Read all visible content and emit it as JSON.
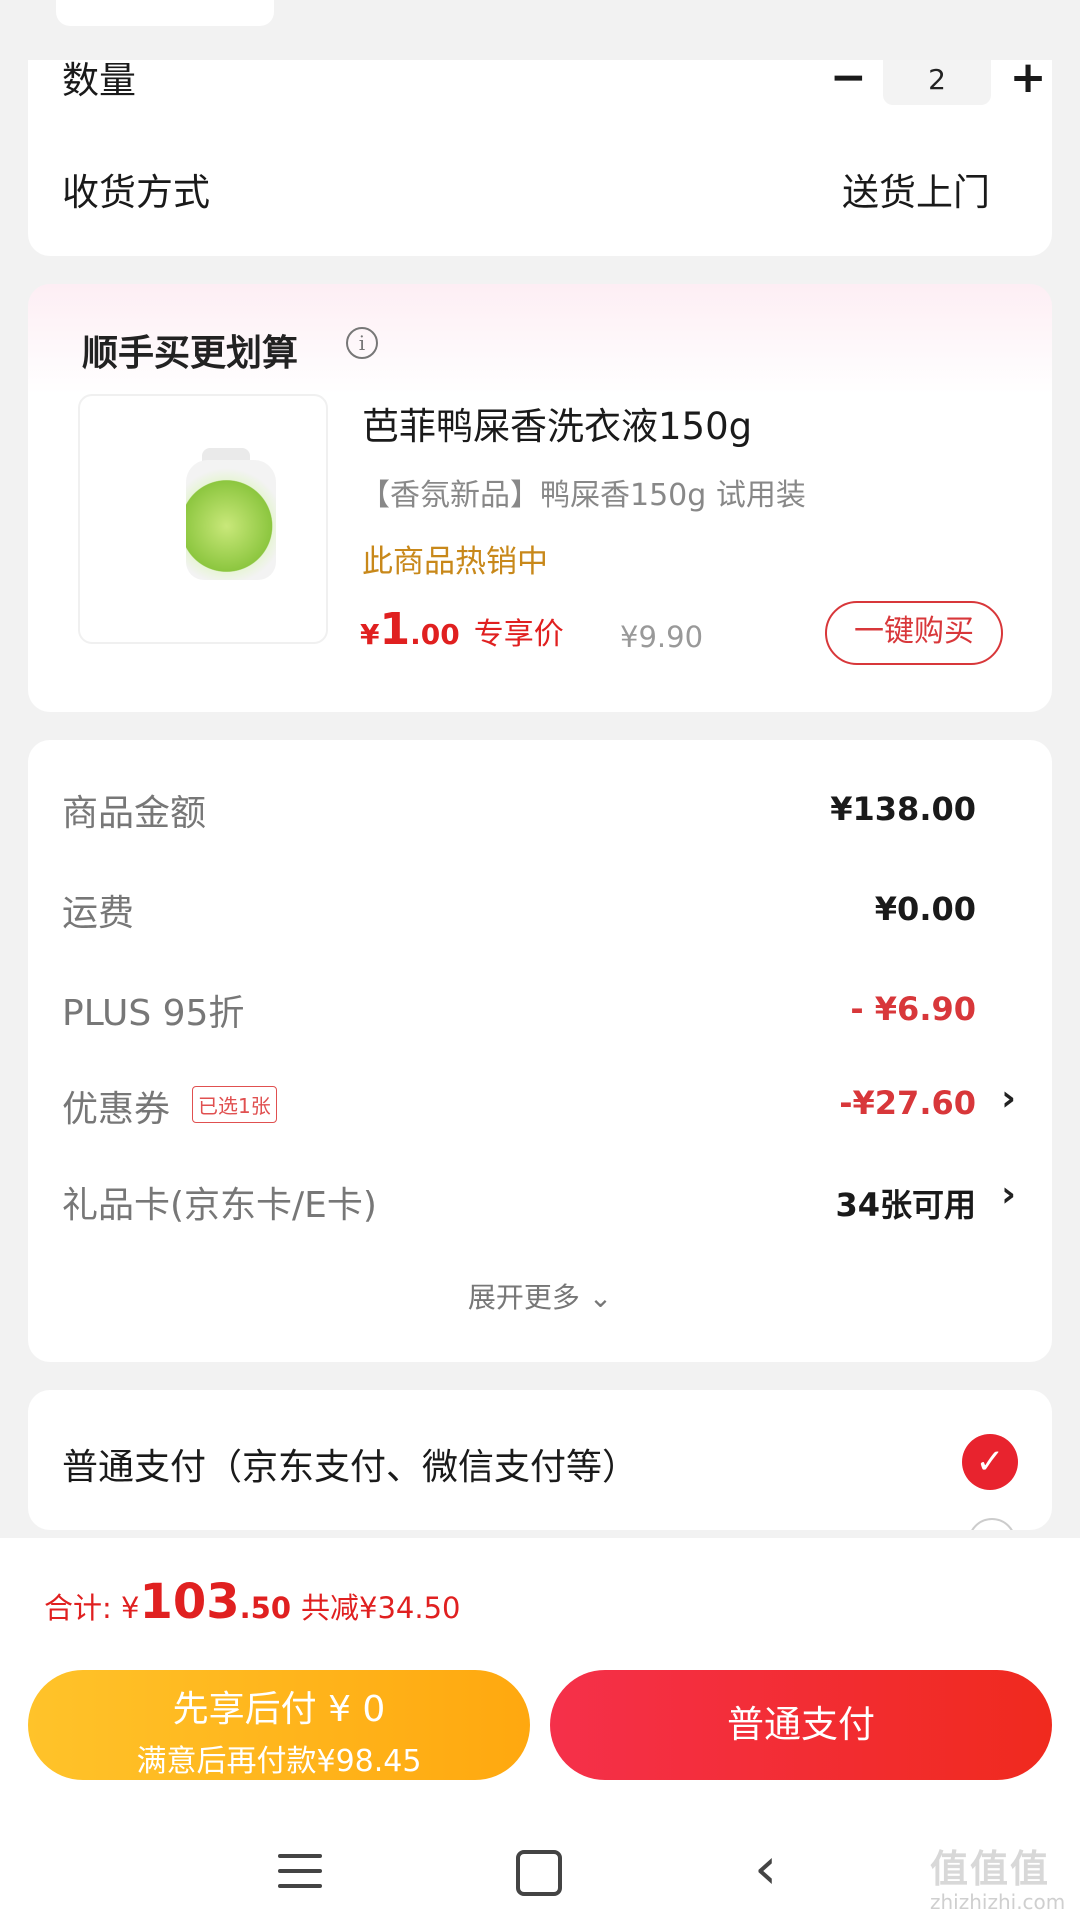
{
  "order": {
    "quantity_label": "数量",
    "quantity_value": "2",
    "minus_symbol": "−",
    "plus_symbol": "+",
    "delivery_label": "收货方式",
    "delivery_value": "送货上门"
  },
  "addon": {
    "title": "顺手买更划算",
    "info_symbol": "i",
    "product_name": "芭菲鸭屎香洗衣液150g",
    "product_sub": "【香氛新品】鸭屎香150g 试用装",
    "hot_text": "此商品热销中",
    "price_symbol": "¥",
    "price_int": "1",
    "price_dec": ".00",
    "price_tag": "专享价",
    "old_price": "¥9.90",
    "buy_button": "一键购买"
  },
  "summary": {
    "goods_label": "商品金额",
    "goods_value": "¥138.00",
    "shipping_label": "运费",
    "shipping_value": "¥0.00",
    "plus_label": "PLUS 95折",
    "plus_value": "- ¥6.90",
    "coupon_label": "优惠券",
    "coupon_badge": "已选1张",
    "coupon_value": "-¥27.60",
    "giftcard_label": "礼品卡(京东卡/E卡)",
    "giftcard_value": "34张可用",
    "chevron": "›",
    "expand_more": "展开更多 ⌄"
  },
  "payment": {
    "method_label": "普通支付（京东支付、微信支付等）",
    "check_symbol": "✓"
  },
  "bottom": {
    "total_label": "合计: ",
    "total_symbol": "¥",
    "total_int": "103",
    "total_dec": ".50",
    "saved_text": "共减¥34.50",
    "later_line1": "先享后付 ¥ 0",
    "later_line2": "满意后再付款¥98.45",
    "pay_button": "普通支付"
  },
  "nav": {
    "back_symbol": "‹"
  },
  "watermark": {
    "text": "值值值",
    "sub": "zhizhizhi.com"
  },
  "colors": {
    "accent_red": "#e02020",
    "orange_button": "#ffb31f",
    "hot_text": "#c8881a"
  }
}
